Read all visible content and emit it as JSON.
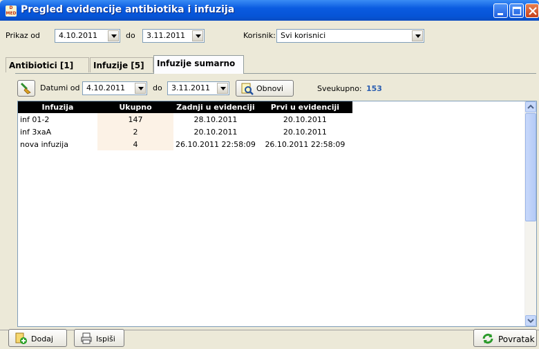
{
  "window": {
    "title": "Pregled evidencije antibiotika i infuzija",
    "icon_text": "MED",
    "controls": [
      "minimize-icon",
      "maximize-icon",
      "close-icon"
    ]
  },
  "filters": {
    "prikaz_od_label": "Prikaz od",
    "prikaz_od_value": "4.10.2011",
    "do_label": "do",
    "do_value": "3.11.2011",
    "korisnik_label": "Korisnik:",
    "korisnik_value": "Svi korisnici"
  },
  "tabs": [
    {
      "label": "Antibiotici [1]",
      "active": false
    },
    {
      "label": "Infuzije [5]",
      "active": false
    },
    {
      "label": "Infuzije sumarno",
      "active": true
    }
  ],
  "toolbar": {
    "datumi_od_label": "Datumi od",
    "datumi_od_value": "4.10.2011",
    "do_label": "do",
    "do_value": "3.11.2011",
    "obnovi_label": "Obnovi",
    "sveukupno_label": "Sveukupno:",
    "sveukupno_value": "153",
    "accent_color": "#2a5db0"
  },
  "table": {
    "columns": [
      "Infuzija",
      "Ukupno",
      "Zadnji u evidenciji",
      "Prvi u evidenciji"
    ],
    "rows": [
      [
        "inf 01-2",
        "147",
        "28.10.2011",
        "20.10.2011"
      ],
      [
        "inf 3xaA",
        "2",
        "20.10.2011",
        "20.10.2011"
      ],
      [
        "nova infuzija",
        "4",
        "26.10.2011 22:58:09",
        "26.10.2011 22:58:09"
      ]
    ]
  },
  "footer": {
    "dodaj_label": "Dodaj",
    "ispisi_label": "Ispiši",
    "povratak_label": "Povratak"
  }
}
